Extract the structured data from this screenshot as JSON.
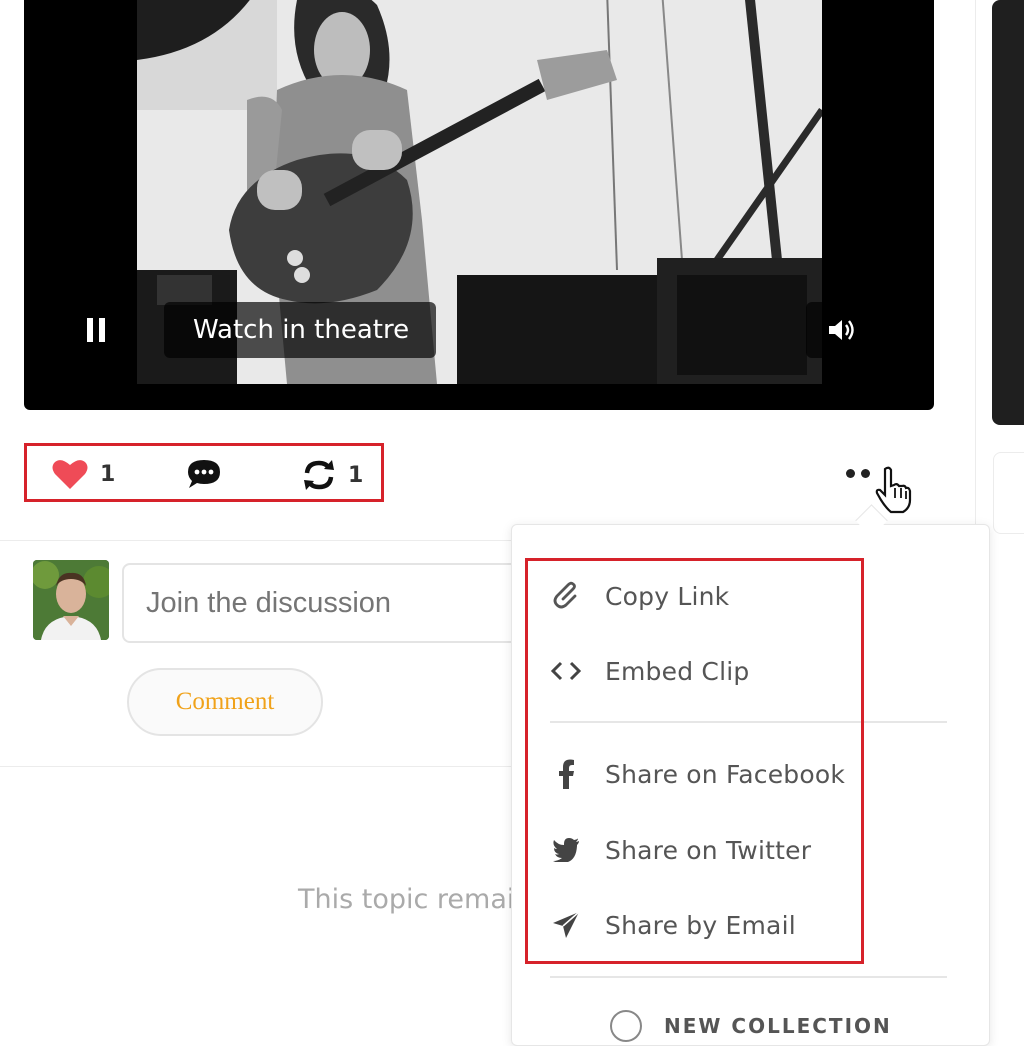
{
  "video": {
    "watch_label": "Watch in theatre",
    "pause_icon": "pause-icon",
    "volume_icon": "volume-icon"
  },
  "actions": {
    "like_count": "1",
    "reshare_count": "1",
    "like_color": "#ef4b57",
    "highlight_color": "#d6222a"
  },
  "comment": {
    "placeholder": "Join the discussion",
    "button_label": "Comment",
    "button_color": "#f0a21a"
  },
  "topic": {
    "text": "This topic remain"
  },
  "share_menu": {
    "items": [
      {
        "label": "Copy Link",
        "icon": "link-icon"
      },
      {
        "label": "Embed Clip",
        "icon": "code-icon"
      },
      {
        "label": "Share on Facebook",
        "icon": "facebook-icon"
      },
      {
        "label": "Share on Twitter",
        "icon": "twitter-icon"
      },
      {
        "label": "Share by Email",
        "icon": "send-icon"
      }
    ],
    "new_collection_label": "NEW COLLECTION"
  }
}
